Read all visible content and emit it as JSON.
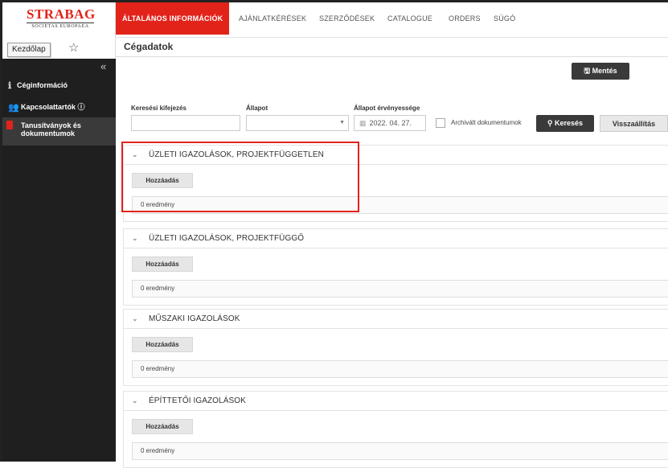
{
  "app": {
    "logo_text": "STRABAG",
    "logo_subtext": "SOCIETAS EUROPAEA",
    "home_button": "Kezdőlap"
  },
  "topnav": {
    "items": [
      "ÁLTALÁNOS INFORMÁCIÓK",
      "AJÁNLATKÉRÉSEK",
      "SZERZŐDÉSEK",
      "CATALOGUE",
      "ORDERS",
      "SÚGÓ"
    ],
    "active_index": 0
  },
  "sidebar": {
    "items": [
      {
        "label": "Céginformáció",
        "icon": "info-icon"
      },
      {
        "label": "Kapcsolattartók ⓘ",
        "icon": "people-icon"
      },
      {
        "label": "Tanusítványok és dokumentumok",
        "icon": "document-icon"
      }
    ]
  },
  "page": {
    "title": "Cégadatok",
    "save_label": "Mentés"
  },
  "filters": {
    "search_label": "Keresési kifejezés",
    "search_value": "",
    "status_label": "Állapot",
    "status_value": "",
    "validity_label": "Állapot érvényessége",
    "validity_value": "2022. 04. 27.",
    "archive_label": "Archivált dokumentumok",
    "search_button": "Keresés",
    "reset_button": "Visszaállítás"
  },
  "sections": [
    {
      "title": "ÜZLETI IGAZOLÁSOK, PROJEKTFÜGGETLEN",
      "add_label": "Hozzáadás",
      "results": "0 eredmény"
    },
    {
      "title": "ÜZLETI IGAZOLÁSOK, PROJEKTFÜGGŐ",
      "add_label": "Hozzáadás",
      "results": "0 eredmény"
    },
    {
      "title": "MŰSZAKI IGAZOLÁSOK",
      "add_label": "Hozzáadás",
      "results": "0 eredmény"
    },
    {
      "title": "ÉPÍTTETŐI IGAZOLÁSOK",
      "add_label": "Hozzáadás",
      "results": "0 eredmény"
    }
  ],
  "colors": {
    "accent": "#e2231a",
    "sidebar_bg": "#1f1f1f",
    "dark_button": "#3a3a3a"
  }
}
